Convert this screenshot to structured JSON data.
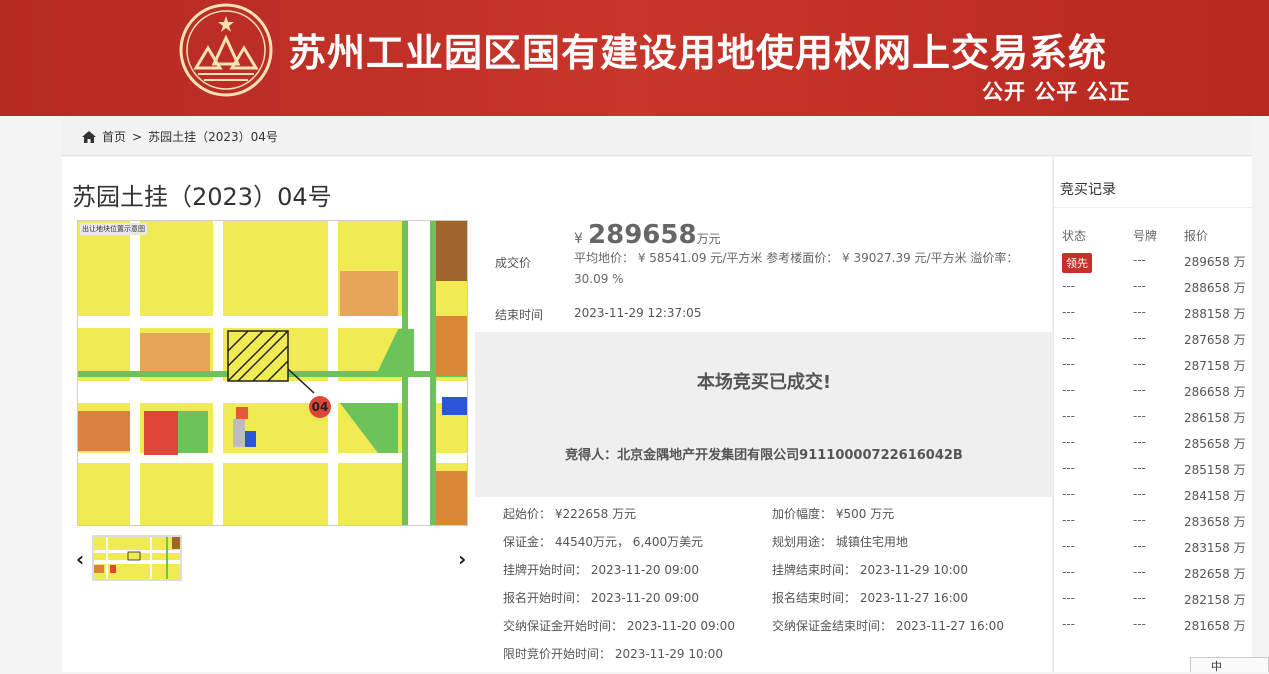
{
  "banner": {
    "title": "苏州工业园区国有建设用地使用权网上交易系统",
    "slogan": "公开 公平 公正"
  },
  "breadcrumb": {
    "home": "首页",
    "sep": ">",
    "current": "苏园土挂（2023）04号"
  },
  "lot": {
    "title": "苏园土挂（2023）04号",
    "map_caption": "出让地块位置示意图",
    "map_plot_no": "04",
    "deal_label": "成交价",
    "price_currency": "¥",
    "price_value": "289658",
    "price_unit": "万元",
    "avg_text": "平均地价： ¥ 58541.09 元/平方米     参考楼面价： ¥ 39027.39 元/平方米     溢价率： 30.09 %",
    "end_label": "结束时间",
    "end_value": "2023-11-29 12:37:05",
    "done_title": "本场竞买已成交!",
    "winner_text": "竞得人：北京金隅地产开发集团有限公司91110000722616042B",
    "prev_glyph": "‹",
    "next_glyph": "›"
  },
  "details": {
    "start_price": "起始价： ¥222658 万元",
    "increment": "加价幅度： ¥500 万元",
    "deposit": "保证金： 44540万元， 6,400万美元",
    "usage": "规划用途： 城镇住宅用地",
    "list_start": "挂牌开始时间： 2023-11-20 09:00",
    "list_end": "挂牌结束时间： 2023-11-29 10:00",
    "reg_start": "报名开始时间： 2023-11-20 09:00",
    "reg_end": "报名结束时间： 2023-11-27 16:00",
    "dep_start": "交纳保证金开始时间： 2023-11-20 09:00",
    "dep_end": "交纳保证金结束时间： 2023-11-27 16:00",
    "timed_start": "限时竞价开始时间： 2023-11-29 10:00"
  },
  "records": {
    "title": "竞买记录",
    "headers": [
      "状态",
      "号牌",
      "报价"
    ],
    "lead_badge": "领先",
    "rows": [
      {
        "status": "领先",
        "plate": "---",
        "price": "289658 万"
      },
      {
        "status": "---",
        "plate": "---",
        "price": "288658 万"
      },
      {
        "status": "---",
        "plate": "---",
        "price": "288158 万"
      },
      {
        "status": "---",
        "plate": "---",
        "price": "287658 万"
      },
      {
        "status": "---",
        "plate": "---",
        "price": "287158 万"
      },
      {
        "status": "---",
        "plate": "---",
        "price": "286658 万"
      },
      {
        "status": "---",
        "plate": "---",
        "price": "286158 万"
      },
      {
        "status": "---",
        "plate": "---",
        "price": "285658 万"
      },
      {
        "status": "---",
        "plate": "---",
        "price": "285158 万"
      },
      {
        "status": "---",
        "plate": "---",
        "price": "284158 万"
      },
      {
        "status": "---",
        "plate": "---",
        "price": "283658 万"
      },
      {
        "status": "---",
        "plate": "---",
        "price": "283158 万"
      },
      {
        "status": "---",
        "plate": "---",
        "price": "282658 万"
      },
      {
        "status": "---",
        "plate": "---",
        "price": "282158 万"
      },
      {
        "status": "---",
        "plate": "---",
        "price": "281658 万"
      }
    ]
  },
  "ime": {
    "label": "中"
  },
  "colors": {
    "banner_red": "#c0302a",
    "badge_red": "#c9302c"
  }
}
